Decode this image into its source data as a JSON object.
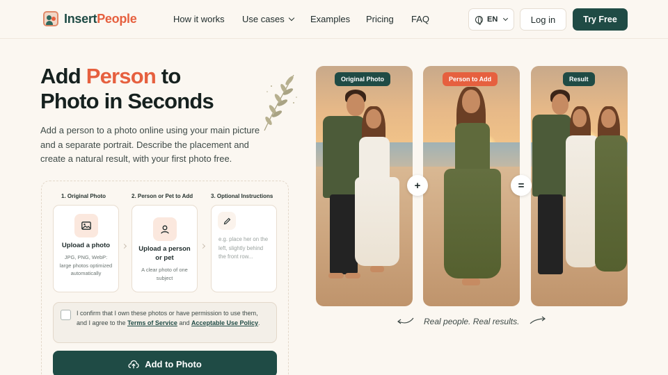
{
  "brand": {
    "part1": "Insert",
    "part2": "People"
  },
  "nav": {
    "items": [
      "How it works",
      "Use cases",
      "Examples",
      "Pricing",
      "FAQ"
    ],
    "lang": "EN",
    "login": "Log in",
    "cta": "Try Free"
  },
  "hero": {
    "title_word1": "Add ",
    "title_accent": "Person",
    "title_rest1": " to",
    "title_line2": "Photo in Seconds",
    "subtitle": "Add a person to a photo online using your main picture and a separate portrait. Describe the placement and create a natural result, with your first photo free."
  },
  "steps": [
    {
      "label": "1. Original Photo",
      "title": "Upload a photo",
      "desc": "JPG, PNG, WebP: large photos optimized automatically",
      "icon": "image-icon"
    },
    {
      "label": "2. Person or Pet to Add",
      "title": "Upload a person or pet",
      "desc": "A clear photo of one subject",
      "icon": "user-icon"
    },
    {
      "label": "3. Optional Instructions",
      "placeholder": "e.g. place her on the left, slightly behind the front row...",
      "icon": "pencil-icon"
    }
  ],
  "consent": {
    "pre": "I confirm that I own these photos or have permission to use them, and I agree to the ",
    "terms": "Terms of Service",
    "and": " and ",
    "policy": "Acceptable Use Policy",
    "end": "."
  },
  "submit": "Add to Photo",
  "showcase": {
    "badges": [
      "Original Photo",
      "Person to Add",
      "Result"
    ],
    "plus": "+",
    "equals": "=",
    "tagline": "Real people. Real results."
  },
  "colors": {
    "primary": "#1f4b45",
    "accent": "#e6603f",
    "background": "#fbf7f1"
  }
}
